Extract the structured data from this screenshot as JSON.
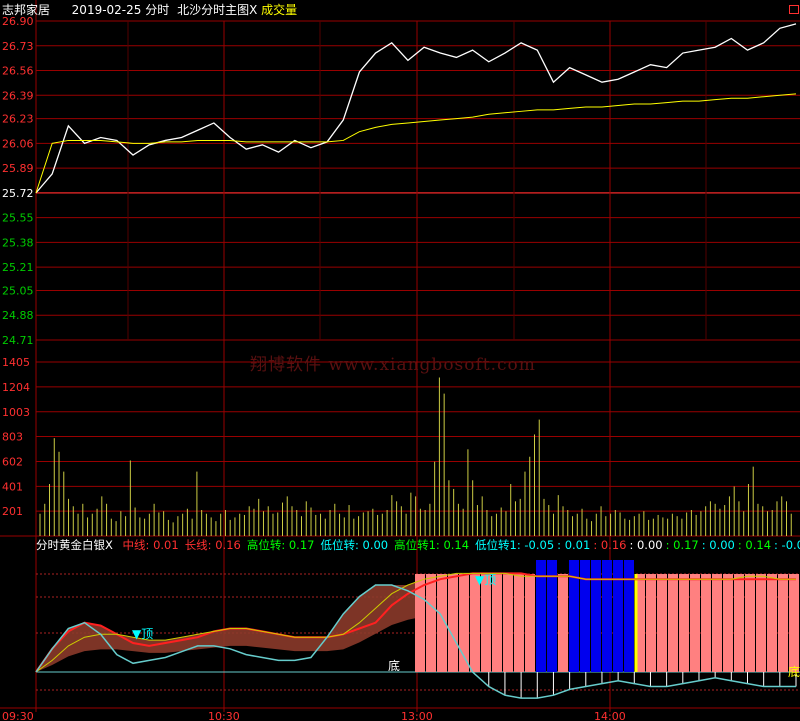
{
  "header": {
    "stock_name": "志邦家居",
    "date": "2019-02-25",
    "mode_label": "分时",
    "indicator1": "北沙分时主图",
    "close_mark": "X",
    "volume_label": "成交量",
    "corner_icon": "window-icon"
  },
  "indicator_header": {
    "name": "分时黄金白银",
    "close_mark": "X",
    "items": [
      {
        "label": "中线:",
        "value": "0.01",
        "color": "#ff3030"
      },
      {
        "label": "长线:",
        "value": "0.16",
        "color": "#ff3030"
      },
      {
        "label": "高位转:",
        "value": "0.17",
        "color": "#00ff00"
      },
      {
        "label": "低位转:",
        "value": "0.00",
        "color": "#00ffff"
      },
      {
        "label": "高位转1:",
        "value": "0.14",
        "color": "#00ff00"
      },
      {
        "label": "低位转1:",
        "value": "-0.05",
        "color": "#00ffff"
      }
    ],
    "extra_values": [
      {
        "value": ": 0.01",
        "color": "#00ffff"
      },
      {
        "value": ": 0.16",
        "color": "#ff3030"
      },
      {
        "value": ": 0.00",
        "color": "#ffffff"
      },
      {
        "value": ": 0.17",
        "color": "#00ff00"
      },
      {
        "value": ": 0.00",
        "color": "#00ffff"
      },
      {
        "value": ": 0.14",
        "color": "#00ff00"
      },
      {
        "value": ": -0.05",
        "color": "#00ffff"
      },
      {
        "value": "×",
        "color": "#00ffff"
      }
    ]
  },
  "watermark": "翔博软件 www.xiangbosoft.com",
  "signals": {
    "top": "顶",
    "bottom": "底",
    "bottom_right": "底",
    "top_marker": "▼"
  },
  "x_ticks": [
    "09:30",
    "10:30",
    "13:00",
    "14:00"
  ],
  "colors": {
    "price_line": "#ffffff",
    "avg_line": "#ffff00",
    "grid": "#990000",
    "up_price": "#ff3030",
    "down_price": "#00cc00",
    "volume_bar": "#cccc44",
    "band_fill": "#8b3a2a",
    "pink_bar": "#ff8080",
    "blue_bar": "#0000ee",
    "cyan_line": "#66cccc"
  },
  "chart_data": [
    {
      "type": "line",
      "series": [
        {
          "values": [
            25.72,
            25.85,
            26.18,
            26.06,
            26.1,
            26.08,
            25.98,
            26.05,
            26.08,
            26.1,
            26.15,
            26.2,
            26.1,
            26.02,
            26.05,
            26.0,
            26.08,
            26.03,
            26.07,
            26.22,
            26.55,
            26.68,
            26.75,
            26.63,
            26.72,
            26.68,
            26.65,
            26.7,
            26.62,
            26.68,
            26.75,
            26.7,
            26.48,
            26.58,
            26.53,
            26.48,
            26.5,
            26.55,
            26.6,
            26.58,
            26.68,
            26.7,
            26.72,
            26.78,
            26.7,
            26.75,
            26.85,
            26.88
          ]
        },
        {
          "values": [
            25.72,
            26.06,
            26.08,
            26.08,
            26.08,
            26.07,
            26.06,
            26.06,
            26.07,
            26.07,
            26.08,
            26.08,
            26.08,
            26.07,
            26.07,
            26.07,
            26.07,
            26.07,
            26.07,
            26.08,
            26.14,
            26.17,
            26.19,
            26.2,
            26.21,
            26.22,
            26.23,
            26.24,
            26.26,
            26.27,
            26.28,
            26.29,
            26.29,
            26.3,
            26.31,
            26.31,
            26.32,
            26.33,
            26.33,
            26.34,
            26.35,
            26.35,
            26.36,
            26.37,
            26.37,
            26.38,
            26.39,
            26.4
          ]
        }
      ],
      "y_ticks": [
        "26.90",
        "26.73",
        "26.56",
        "26.39",
        "26.23",
        "26.06",
        "25.89",
        "25.72",
        "25.55",
        "25.38",
        "25.21",
        "25.05",
        "24.88",
        "24.71"
      ],
      "ylim": [
        24.71,
        26.9
      ],
      "baseline": 25.72
    },
    {
      "type": "bar",
      "y_ticks": [
        "1405",
        "1204",
        "1003",
        "803",
        "602",
        "401",
        "201"
      ],
      "ylim": [
        0,
        1405
      ],
      "values": [
        180,
        260,
        420,
        790,
        680,
        520,
        300,
        240,
        180,
        260,
        150,
        180,
        220,
        320,
        260,
        140,
        120,
        200,
        160,
        610,
        230,
        150,
        140,
        180,
        260,
        190,
        200,
        130,
        110,
        160,
        180,
        220,
        140,
        520,
        210,
        180,
        150,
        120,
        180,
        210,
        130,
        150,
        180,
        170,
        240,
        220,
        300,
        200,
        240,
        180,
        190,
        270,
        320,
        240,
        210,
        160,
        280,
        230,
        170,
        180,
        140,
        210,
        260,
        180,
        150,
        250,
        140,
        160,
        190,
        200,
        220,
        170,
        180,
        210,
        330,
        280,
        240,
        180,
        350,
        320,
        220,
        210,
        260,
        600,
        1280,
        1150,
        450,
        380,
        260,
        220,
        700,
        450,
        250,
        320,
        210,
        160,
        180,
        230,
        200,
        420,
        280,
        300,
        520,
        640,
        820,
        940,
        300,
        250,
        180,
        330,
        240,
        210,
        160,
        180,
        220,
        140,
        120,
        180,
        240,
        160,
        180,
        210,
        190,
        140,
        130,
        160,
        180,
        200,
        130,
        140,
        170,
        150,
        140,
        180,
        160,
        140,
        190,
        210,
        170,
        200,
        240,
        280,
        260,
        220,
        250,
        320,
        400,
        280,
        200,
        420,
        560,
        260,
        240,
        200,
        210,
        280,
        320,
        280,
        180
      ]
    },
    {
      "type": "area",
      "series": [
        {
          "name": "中线",
          "values": [
            0,
            0.08,
            0.14,
            0.17,
            0.16,
            0.13,
            0.1,
            0.09,
            0.1,
            0.11,
            0.12,
            0.14,
            0.15,
            0.15,
            0.14,
            0.13,
            0.12,
            0.12,
            0.12,
            0.13,
            0.15,
            0.17,
            0.23,
            0.27,
            0.3,
            0.32,
            0.33,
            0.34,
            0.34,
            0.34,
            0.34,
            0.33,
            0.33,
            0.33,
            0.32,
            0.32,
            0.32,
            0.32,
            0.32,
            0.32,
            0.32,
            0.32,
            0.32,
            0.32,
            0.32,
            0.32,
            0.32,
            0.32
          ]
        },
        {
          "name": "长线",
          "values": [
            0,
            0.04,
            0.09,
            0.12,
            0.13,
            0.13,
            0.12,
            0.11,
            0.11,
            0.12,
            0.13,
            0.14,
            0.15,
            0.15,
            0.14,
            0.13,
            0.12,
            0.12,
            0.12,
            0.13,
            0.17,
            0.22,
            0.27,
            0.3,
            0.32,
            0.33,
            0.34,
            0.34,
            0.34,
            0.34,
            0.33,
            0.33,
            0.33,
            0.33,
            0.32,
            0.32,
            0.32,
            0.32,
            0.32,
            0.32,
            0.32,
            0.32,
            0.32,
            0.32,
            0.33,
            0.33,
            0.32,
            0.32
          ]
        },
        {
          "name": "低位转",
          "values": [
            0,
            0.08,
            0.15,
            0.17,
            0.13,
            0.06,
            0.03,
            0.04,
            0.05,
            0.07,
            0.09,
            0.09,
            0.08,
            0.06,
            0.05,
            0.04,
            0.04,
            0.05,
            0.12,
            0.2,
            0.26,
            0.3,
            0.3,
            0.28,
            0.25,
            0.2,
            0.1,
            0,
            -0.05,
            -0.08,
            -0.09,
            -0.09,
            -0.08,
            -0.06,
            -0.05,
            -0.04,
            -0.03,
            -0.04,
            -0.05,
            -0.05,
            -0.04,
            -0.03,
            -0.02,
            -0.03,
            -0.04,
            -0.05,
            -0.05,
            -0.05
          ]
        }
      ]
    }
  ]
}
